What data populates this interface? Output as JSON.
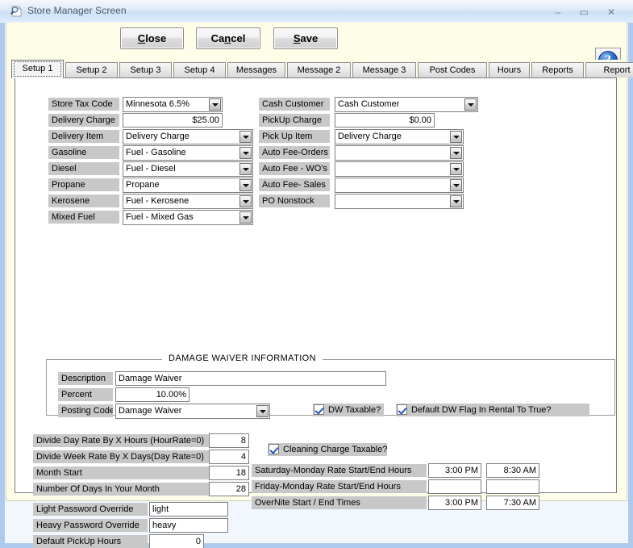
{
  "window": {
    "title": "Store Manager Screen",
    "icon": "magnifier-document-icon",
    "minimize": "–",
    "maximize": "▭",
    "close": "✕"
  },
  "toolbar": {
    "close_label": "Close",
    "close_accel": "C",
    "cancel_label": "Cancel",
    "cancel_accel": "n",
    "save_label": "Save",
    "save_accel": "S",
    "help_glyph": "?"
  },
  "tabs": [
    {
      "label": "Setup 1",
      "active": true
    },
    {
      "label": "Setup 2",
      "active": false
    },
    {
      "label": "Setup 3",
      "active": false
    },
    {
      "label": "Setup 4",
      "active": false
    },
    {
      "label": "Messages",
      "active": false
    },
    {
      "label": "Message 2",
      "active": false
    },
    {
      "label": "Message 3",
      "active": false
    },
    {
      "label": "Post Codes",
      "active": false
    },
    {
      "label": "Hours",
      "active": false
    },
    {
      "label": "Reports",
      "active": false
    },
    {
      "label": "Report Order Terms",
      "active": false
    }
  ],
  "left_fields": [
    {
      "label": "Store Tax Code",
      "value": "Minnesota 6.5%",
      "type": "combo"
    },
    {
      "label": "Delivery Charge",
      "value": "$25.00",
      "type": "text-right"
    },
    {
      "label": "Delivery Item",
      "value": "Delivery Charge",
      "type": "combo"
    },
    {
      "label": "Gasoline",
      "value": "Fuel - Gasoline",
      "type": "combo"
    },
    {
      "label": "Diesel",
      "value": "Fuel - Diesel",
      "type": "combo"
    },
    {
      "label": "Propane",
      "value": "Propane",
      "type": "combo"
    },
    {
      "label": "Kerosene",
      "value": "Fuel - Kerosene",
      "type": "combo"
    },
    {
      "label": "Mixed Fuel",
      "value": "Fuel - Mixed Gas",
      "type": "combo"
    }
  ],
  "right_fields": [
    {
      "label": "Cash Customer",
      "value": "Cash Customer",
      "type": "combo"
    },
    {
      "label": "PickUp Charge",
      "value": "$0.00",
      "type": "text-right"
    },
    {
      "label": "Pick Up Item",
      "value": "Delivery Charge",
      "type": "combo"
    },
    {
      "label": "Auto Fee-Orders",
      "value": "",
      "type": "combo"
    },
    {
      "label": "Auto Fee - WO's",
      "value": "",
      "type": "combo"
    },
    {
      "label": "Auto Fee- Sales",
      "value": "",
      "type": "combo"
    },
    {
      "label": "PO Nonstock",
      "value": "",
      "type": "combo"
    }
  ],
  "damage_waiver": {
    "caption": "DAMAGE WAIVER INFORMATION",
    "description_label": "Description",
    "description_value": "Damage Waiver",
    "percent_label": "Percent",
    "percent_value": "10.00%",
    "posting_code_label": "Posting Code",
    "posting_code_value": "Damage Waiver",
    "dw_taxable_label": "DW Taxable?",
    "dw_taxable_checked": true,
    "default_dw_label": "Default DW Flag In Rental To True?",
    "default_dw_checked": true
  },
  "rates": [
    {
      "label": "Divide Day Rate By X Hours (HourRate=0)",
      "value": "8"
    },
    {
      "label": "Divide Week Rate By X Days(Day Rate=0)",
      "value": "4"
    },
    {
      "label": "Month Start",
      "value": "18"
    },
    {
      "label": "Number Of Days In Your Month",
      "value": "28"
    }
  ],
  "passwords": [
    {
      "label": "Light Password Override",
      "value": "light"
    },
    {
      "label": "Heavy Password Override",
      "value": "heavy"
    },
    {
      "label": "Default PickUp Hours",
      "value": "0"
    }
  ],
  "cleaning": {
    "label": "Cleaning Charge Taxable?",
    "checked": true
  },
  "hours": [
    {
      "label": "Saturday-Monday Rate  Start/End Hours",
      "start": "3:00 PM",
      "end": "8:30 AM"
    },
    {
      "label": "Friday-Monday Rate  Start/End Hours",
      "start": "",
      "end": ""
    },
    {
      "label": "OverNite Start / End Times",
      "start": "3:00 PM",
      "end": "7:30 AM"
    }
  ],
  "colors": {
    "window_border": "#aecbee",
    "command_bar": "#fdfde8",
    "panel": "#ffffff",
    "label_gray": "#c8c8c8",
    "check_blue": "#2a58b5"
  }
}
